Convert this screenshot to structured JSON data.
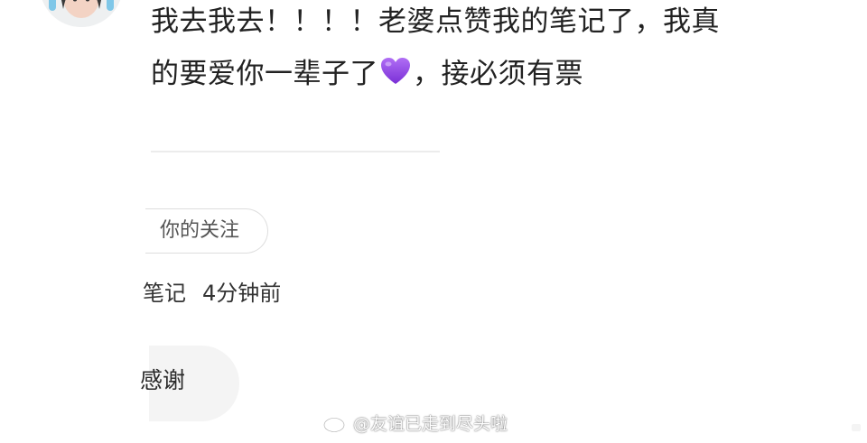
{
  "comment": {
    "line1": "我去我去！！！！老婆点赞我的笔记了，我真",
    "line2_before_emoji": "的要爱你一辈子了",
    "emoji": "purple-heart",
    "line2_after_emoji": "，接必须有票"
  },
  "follow_chip": {
    "label": "你的关注"
  },
  "notification": {
    "label_fragment": "笔记",
    "time": "4分钟前"
  },
  "reply_button": {
    "label": "感谢"
  },
  "watermark": {
    "text": "@友谊已走到尽头啦"
  },
  "colors": {
    "heart": "#8e46e6",
    "chip_border": "#dedede",
    "bubble_bg": "#f4f4f4"
  }
}
